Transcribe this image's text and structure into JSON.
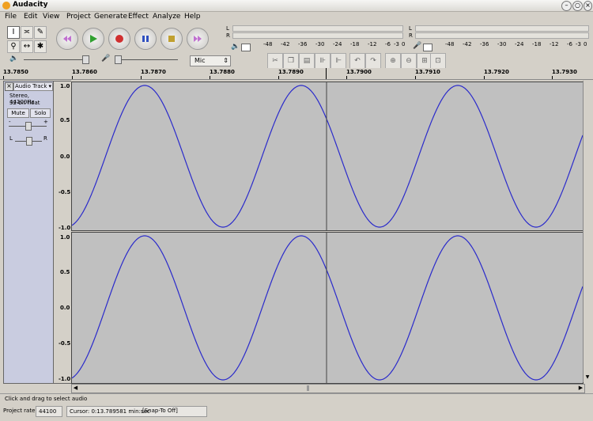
{
  "window": {
    "title": "Audacity"
  },
  "menu": [
    "File",
    "Edit",
    "View",
    "Project",
    "Generate",
    "Effect",
    "Analyze",
    "Help"
  ],
  "meters": {
    "ticks": [
      "-48",
      "-42",
      "-36",
      "-30",
      "-24",
      "-18",
      "-12",
      "-6",
      "-3",
      "0"
    ],
    "ch_l": "L",
    "ch_r": "R"
  },
  "mixer": {
    "input_source": "Mic"
  },
  "ruler": {
    "labels": [
      "13.7850",
      "13.7860",
      "13.7870",
      "13.7880",
      "13.7890",
      "13.7900",
      "13.7910",
      "13.7920",
      "13.7930"
    ]
  },
  "track": {
    "name": "Audio Track",
    "info1": "Stereo, 44100Hz",
    "info2": "32-bit float",
    "mute": "Mute",
    "solo": "Solo",
    "gain_minus": "-",
    "gain_plus": "+",
    "pan_l": "L",
    "pan_r": "R",
    "y_labels": [
      "1.0",
      "0.5",
      "0.0",
      "-0.5",
      "-1.0"
    ]
  },
  "status": {
    "hint": "Click and drag to select audio",
    "rate_label": "Project rate:",
    "rate": "44100",
    "cursor": "Cursor: 0:13.789581 min:sec",
    "snap": "[Snap-To Off]"
  },
  "colors": {
    "wave": "#2a2acb",
    "bg": "#d4d0c8"
  }
}
